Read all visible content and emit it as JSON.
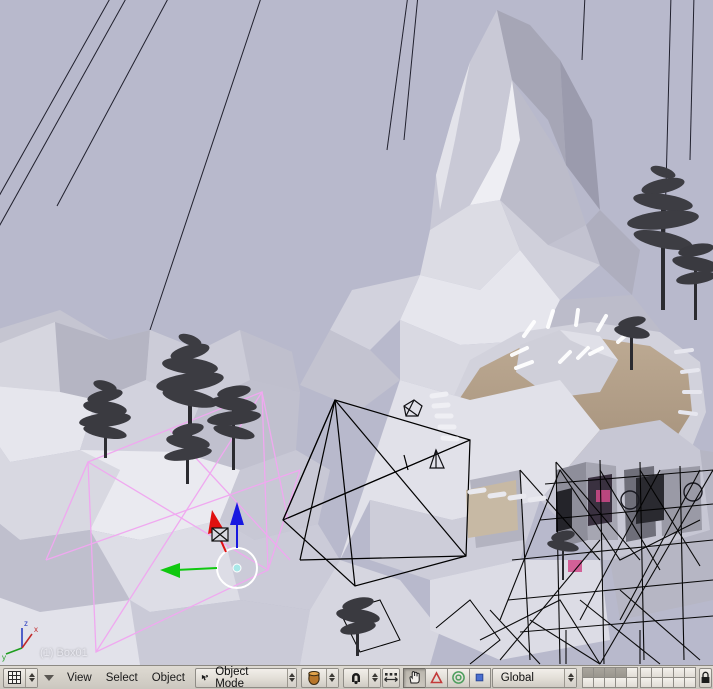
{
  "app": {
    "name": "Blender 3D Viewport",
    "background_color": "#b8b9cc"
  },
  "viewport": {
    "object_label": "(1) Box01",
    "axis_gizmo": {
      "x_label": "x",
      "y_label": "y",
      "z_label": "z",
      "x_color": "#c02a2a",
      "y_color": "#1f9e1f",
      "z_color": "#2a3ec0"
    },
    "manipulator": {
      "type": "translate-manipulator",
      "x_arrow_color": "#e01010",
      "y_arrow_color": "#10c810",
      "z_arrow_color": "#1818e0",
      "center_ring_color": "#ffffff",
      "center_dot_color": "#a8e8e8"
    },
    "selection_wire_color": "#f0a8f0",
    "wireframe_color": "#000000",
    "colors": {
      "sky": "#b8b9cc",
      "terrain_light": "#e9e9ee",
      "terrain_mid": "#cfcfda",
      "terrain_dark": "#a9a9b8",
      "sand": "#b9a48e",
      "sand_dark": "#a8937c",
      "tree_dark": "#3a3a3f",
      "rock_highlight": "#f4f4f8"
    },
    "scene_objects": [
      "low-poly-mountain",
      "crater-bowl",
      "conifer-trees",
      "camera-gizmo",
      "cone-lamp-gizmo",
      "cylinder-props",
      "wireframe-boxes"
    ]
  },
  "header": {
    "window_type_icon": "grid-editor-type-icon",
    "dropdown_caret": "chevron-down-icon",
    "menus": [
      {
        "label": "View",
        "name": "view-menu"
      },
      {
        "label": "Select",
        "name": "select-menu"
      },
      {
        "label": "Object",
        "name": "object-menu"
      }
    ],
    "mode_select": {
      "label": "Object Mode",
      "icon": "object-mode-cursor-icon"
    },
    "draw_type": {
      "icon": "solid-shading-icon"
    },
    "pivot": {
      "icon": "pivot-median-point-icon"
    },
    "snap": {
      "icon": "proportional-edit-icon"
    },
    "manipulator_toggle": {
      "icon": "hand-manipulator-icon",
      "active": true
    },
    "transform_buttons": [
      {
        "name": "translate-manipulator-button",
        "icon": "translate-triangle-icon",
        "color": "#d04040",
        "active": false
      },
      {
        "name": "rotate-manipulator-button",
        "icon": "rotate-circle-icon",
        "color": "#4f9f5f",
        "active": false
      },
      {
        "name": "scale-manipulator-button",
        "icon": "scale-square-icon",
        "color": "#4a6fd0",
        "active": false
      }
    ],
    "orientation_select": {
      "label": "Global"
    },
    "layers": {
      "block1": [
        1,
        1,
        1,
        1,
        0,
        0,
        0,
        0,
        0,
        0
      ],
      "block2": [
        0,
        0,
        0,
        0,
        0,
        0,
        0,
        0,
        0,
        0
      ]
    },
    "lock_button": {
      "icon": "lock-icon",
      "name": "lock-layers-button"
    }
  }
}
